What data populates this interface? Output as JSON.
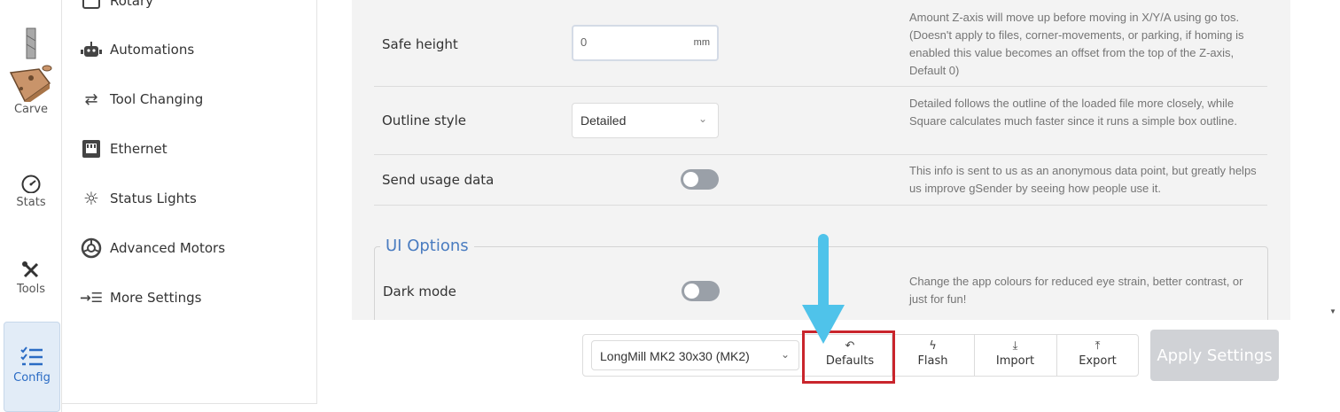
{
  "rail": {
    "items": [
      {
        "label": "Carve",
        "icon": "carve-router-icon"
      },
      {
        "label": "Stats",
        "icon": "gauge-icon"
      },
      {
        "label": "Tools",
        "icon": "tools-icon"
      },
      {
        "label": "Config",
        "icon": "checklist-icon",
        "active": true
      }
    ]
  },
  "menu": {
    "items": [
      {
        "label": "Rotary",
        "icon": "rotary-icon"
      },
      {
        "label": "Automations",
        "icon": "robot-icon"
      },
      {
        "label": "Tool Changing",
        "icon": "swap-arrows-icon"
      },
      {
        "label": "Ethernet",
        "icon": "ethernet-port-icon"
      },
      {
        "label": "Status Lights",
        "icon": "sun-icon"
      },
      {
        "label": "Advanced Motors",
        "icon": "motor-icon"
      },
      {
        "label": "More Settings",
        "icon": "indent-list-icon"
      }
    ]
  },
  "settings": {
    "top_desc": "Amount Z-axis will move up before moving in X/Y/A using go tos. (Doesn't apply to files, corner-movements, or parking, if homing is enabled this value becomes an offset from the top of the Z-axis, Default 0)",
    "safe_height": {
      "label": "Safe height",
      "value": "0",
      "unit": "mm"
    },
    "outline_style": {
      "label": "Outline style",
      "value": "Detailed",
      "desc": "Detailed follows the outline of the loaded file more closely, while Square calculates much faster since it runs a simple box outline."
    },
    "usage_data": {
      "label": "Send usage data",
      "enabled": false,
      "desc": "This info is sent to us as an anonymous data point, but greatly helps us improve gSender by seeing how people use it."
    },
    "ui_options": {
      "title": "UI Options",
      "dark_mode": {
        "label": "Dark mode",
        "enabled": false,
        "desc": "Change the app colours for reduced eye strain, better contrast, or just for fun!"
      }
    }
  },
  "actions": {
    "profile": "LongMill MK2 30x30 (MK2)",
    "defaults": "Defaults",
    "flash": "Flash",
    "import": "Import",
    "export": "Export",
    "apply": "Apply Settings"
  },
  "colors": {
    "accent": "#4a7cc0",
    "highlight_box": "#c9252c",
    "pointer_arrow": "#4fc3ea"
  }
}
